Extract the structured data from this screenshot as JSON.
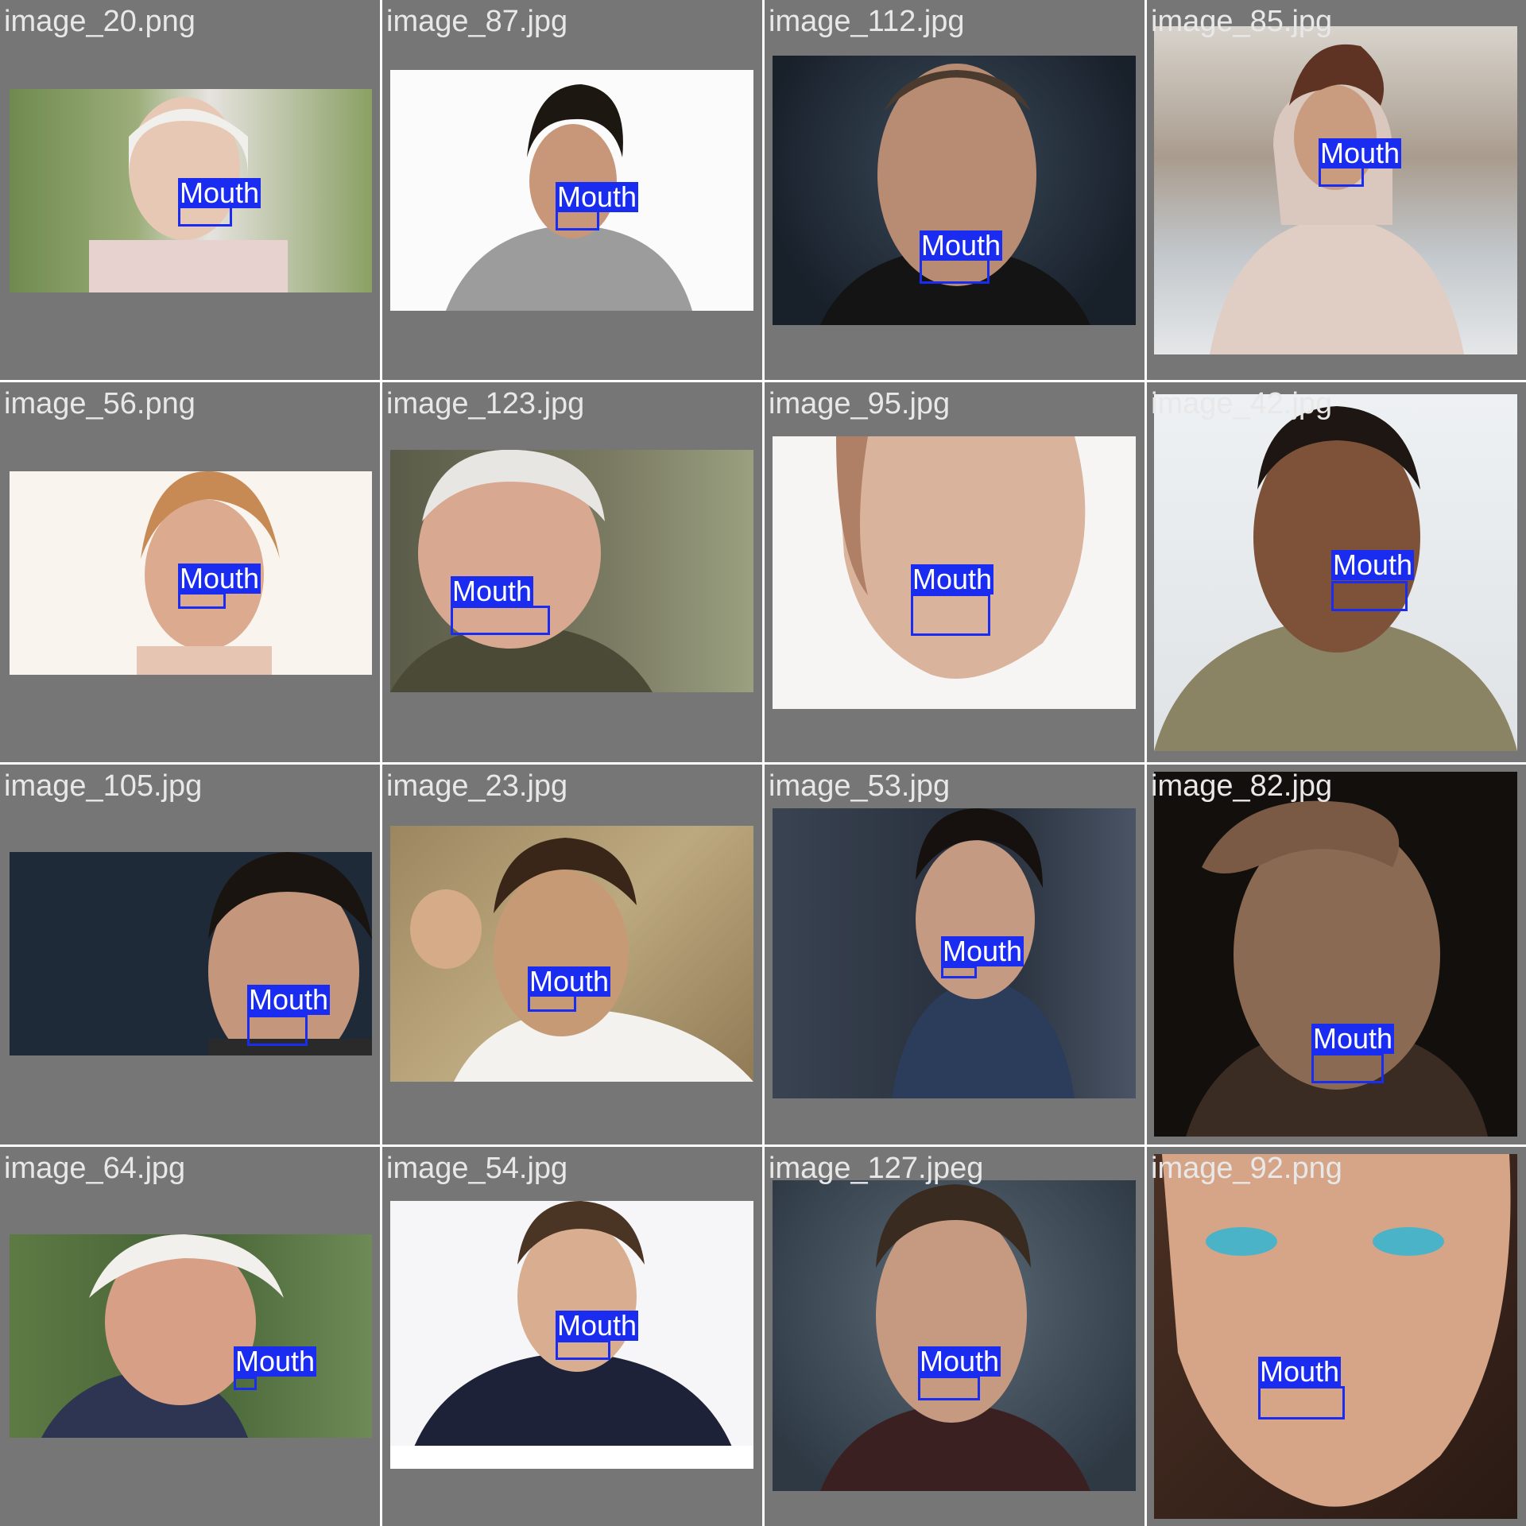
{
  "tiles": [
    {
      "filename": "image_20.png",
      "label": "Mouth",
      "bg": "#7d8e5c",
      "subject": "elderly-woman-smiling"
    },
    {
      "filename": "image_87.jpg",
      "label": "Mouth",
      "bg": "#f4f4f4",
      "subject": "man-dark-hair-smiling"
    },
    {
      "filename": "image_112.jpg",
      "label": "Mouth",
      "bg": "#1f2a36",
      "subject": "man-intense-stare"
    },
    {
      "filename": "image_85.jpg",
      "label": "Mouth",
      "bg": "#b7b2aa",
      "subject": "young-man-hoodie"
    },
    {
      "filename": "image_56.png",
      "label": "Mouth",
      "bg": "#f7f1ea",
      "subject": "elderly-woman-red-lips"
    },
    {
      "filename": "image_123.jpg",
      "label": "Mouth",
      "bg": "#6b6a52",
      "subject": "elderly-man-smiling"
    },
    {
      "filename": "image_95.jpg",
      "label": "Mouth",
      "bg": "#f2e8e0",
      "subject": "man-face-closeup"
    },
    {
      "filename": "image_42.jpg",
      "label": "Mouth",
      "bg": "#9e7f5f",
      "subject": "man-smiling-beard"
    },
    {
      "filename": "image_105.jpg",
      "label": "Mouth",
      "bg": "#1e2938",
      "subject": "man-dark-background"
    },
    {
      "filename": "image_23.jpg",
      "label": "Mouth",
      "bg": "#a9946a",
      "subject": "man-hand-on-head"
    },
    {
      "filename": "image_53.jpg",
      "label": "Mouth",
      "bg": "#2a3444",
      "subject": "man-blue-shirt"
    },
    {
      "filename": "image_82.jpg",
      "label": "Mouth",
      "bg": "#2b231d",
      "subject": "elderly-man-wrinkled"
    },
    {
      "filename": "image_64.jpg",
      "label": "Mouth",
      "bg": "#4f6a3e",
      "subject": "elderly-man-glasses"
    },
    {
      "filename": "image_54.jpg",
      "label": "Mouth",
      "bg": "#f4f4f6",
      "subject": "young-man-navy-shirt"
    },
    {
      "filename": "image_127.jpeg",
      "label": "Mouth",
      "bg": "#3d4a55",
      "subject": "man-beard-portrait"
    },
    {
      "filename": "image_92.png",
      "label": "Mouth",
      "bg": "#c9a48a",
      "subject": "woman-digital-portrait"
    }
  ]
}
